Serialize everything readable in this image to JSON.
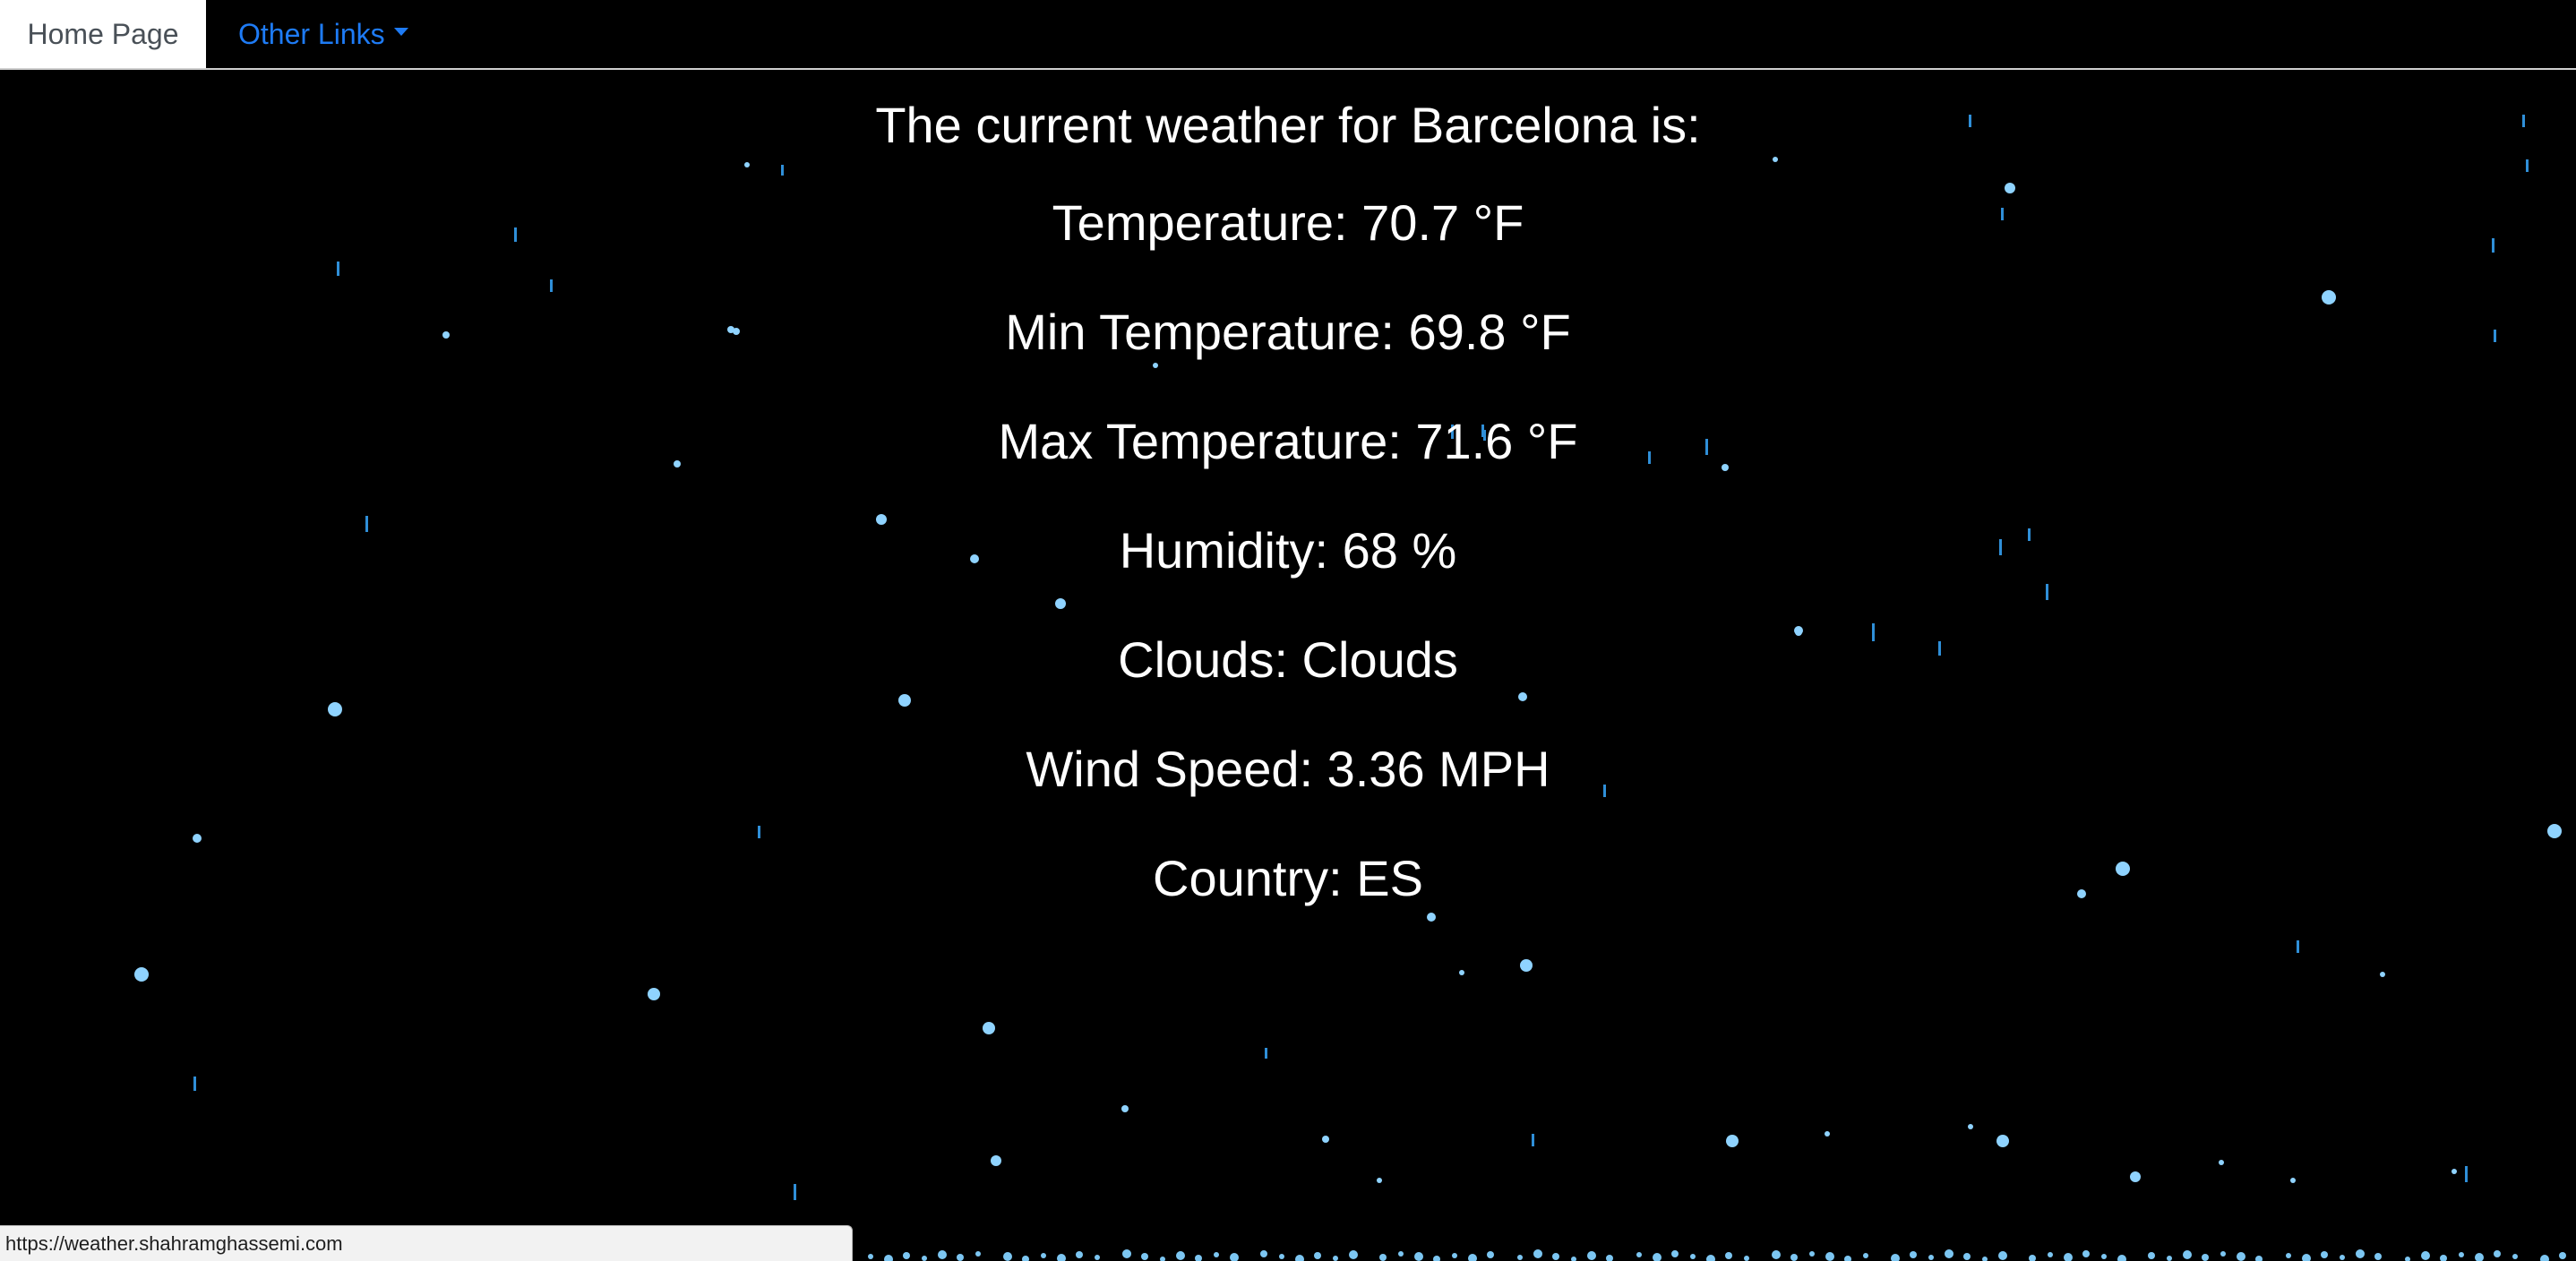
{
  "nav": {
    "home_label": "Home Page",
    "other_links_label": "Other Links"
  },
  "weather": {
    "heading": "The current weather for Barcelona is:",
    "temperature": "Temperature: 70.7 °F",
    "min_temperature": "Min Temperature: 69.8 °F",
    "max_temperature": "Max Temperature: 71.6 °F",
    "humidity": "Humidity: 68 %",
    "clouds": "Clouds: Clouds",
    "wind_speed": "Wind Speed: 3.36 MPH",
    "country": "Country: ES"
  },
  "status_bar": {
    "url": "https://weather.shahramghassemi.com"
  },
  "colors": {
    "background": "#000000",
    "link": "#1e7bf5",
    "raindrop": "#8fd3ff",
    "text": "#ffffff"
  }
}
